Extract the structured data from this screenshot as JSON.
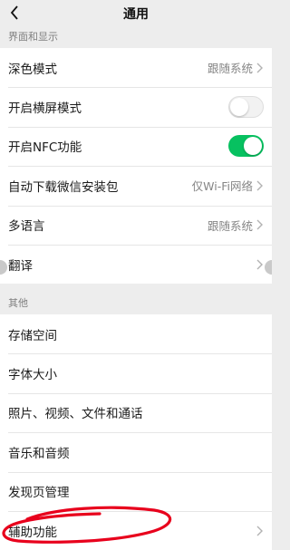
{
  "header": {
    "title": "通用",
    "back_icon": "chevron-left-icon"
  },
  "sections": [
    {
      "label": "界面和显示",
      "rows": [
        {
          "label": "深色模式",
          "value": "跟随系统",
          "control": "chevron"
        },
        {
          "label": "开启横屏模式",
          "control": "toggle",
          "toggle_on": false
        },
        {
          "label": "开启NFC功能",
          "control": "toggle",
          "toggle_on": true
        },
        {
          "label": "自动下载微信安装包",
          "value": "仅Wi-Fi网络",
          "control": "chevron"
        },
        {
          "label": "多语言",
          "value": "跟随系统",
          "control": "chevron"
        },
        {
          "label": "翻译",
          "control": "chevron"
        }
      ]
    },
    {
      "label": "其他",
      "rows": [
        {
          "label": "存储空间"
        },
        {
          "label": "字体大小"
        },
        {
          "label": "照片、视频、文件和通话"
        },
        {
          "label": "音乐和音频"
        },
        {
          "label": "发现页管理"
        },
        {
          "label": "辅助功能",
          "control": "chevron"
        }
      ]
    }
  ],
  "colors": {
    "background": "#ededed",
    "toggle_on": "#07c160",
    "annotation": "#e8001c"
  }
}
